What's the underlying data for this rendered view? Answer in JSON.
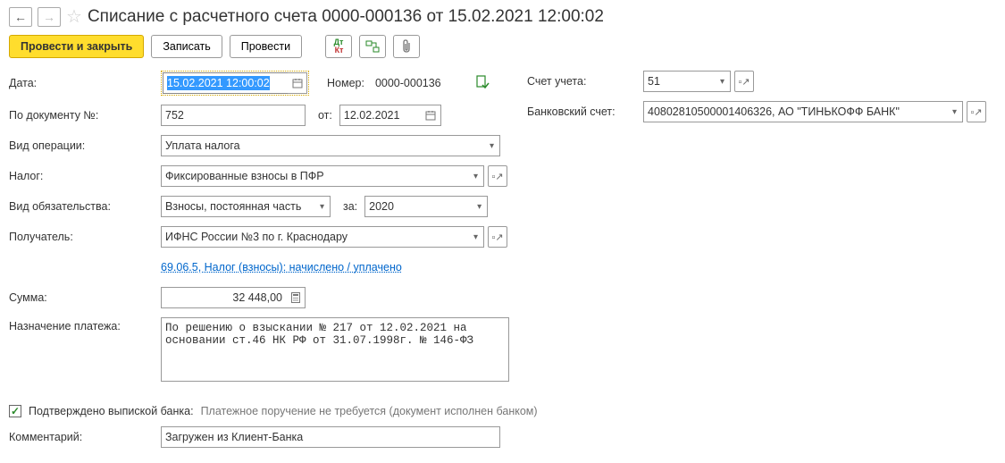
{
  "header": {
    "title": "Списание с расчетного счета 0000-000136 от 15.02.2021 12:00:02"
  },
  "toolbar": {
    "post_and_close": "Провести и закрыть",
    "save": "Записать",
    "post": "Провести"
  },
  "left": {
    "date_lbl": "Дата:",
    "date_val": "15.02.2021 12:00:02",
    "number_lbl": "Номер:",
    "number_val": "0000-000136",
    "doc_no_lbl": "По документу №:",
    "doc_no_val": "752",
    "from_lbl": "от:",
    "from_val": "12.02.2021",
    "op_type_lbl": "Вид операции:",
    "op_type_val": "Уплата налога",
    "tax_lbl": "Налог:",
    "tax_val": "Фиксированные взносы в ПФР",
    "obl_lbl": "Вид обязательства:",
    "obl_val": "Взносы, постоянная часть",
    "for_lbl": "за:",
    "for_val": "2020",
    "recipient_lbl": "Получатель:",
    "recipient_val": "ИФНС России №3 по г. Краснодару",
    "link": "69.06.5, Налог (взносы): начислено / уплачено",
    "sum_lbl": "Сумма:",
    "sum_val": "32 448,00",
    "purpose_lbl": "Назначение платежа:",
    "purpose_val": "По решению о взыскании № 217 от 12.02.2021 на основании ст.46 НК РФ от 31.07.1998г. № 146-ФЗ"
  },
  "right": {
    "acct_lbl": "Счет учета:",
    "acct_val": "51",
    "bank_lbl": "Банковский счет:",
    "bank_val": "40802810500001406326, АО \"ТИНЬКОФФ БАНК\""
  },
  "footer": {
    "confirmed_lbl": "Подтверждено выпиской банка:",
    "info": "Платежное поручение не требуется (документ исполнен банком)",
    "comment_lbl": "Комментарий:",
    "comment_val": "Загружен из Клиент-Банка"
  }
}
